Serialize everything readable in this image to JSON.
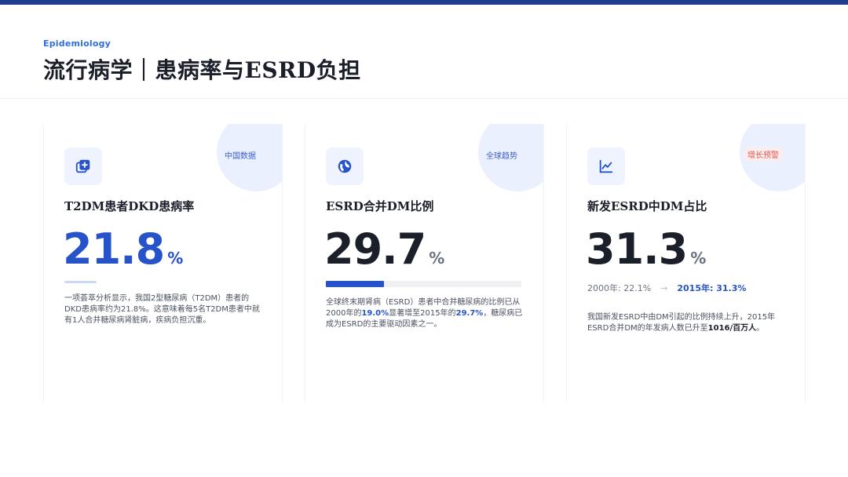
{
  "header": {
    "eyebrow": "Epidemiology",
    "title": "流行病学｜患病率与ESRD负担"
  },
  "cards": [
    {
      "tag": "中国数据",
      "icon": "medical-plus-icon",
      "title": "T2DM患者DKD患病率",
      "value": "21.8",
      "unit": "%",
      "desc": "一项荟萃分析显示，我国2型糖尿病（T2DM）患者的DKD患病率约为21.8%。这意味着每5名T2DM患者中就有1人合并糖尿病肾脏病，疾病负担沉重。"
    },
    {
      "tag": "全球趋势",
      "icon": "globe-icon",
      "title": "ESRD合并DM比例",
      "value": "29.7",
      "unit": "%",
      "progress": 0.297,
      "desc_parts": {
        "p1": "全球终末期肾病（ESRD）患者中合并糖尿病的比例已从2000年的",
        "v1": "19.0%",
        "p2": "显著增至2015年的",
        "v2": "29.7%",
        "p3": "，糖尿病已成为ESRD的主要驱动因素之一。"
      }
    },
    {
      "tag": "增长预警",
      "icon": "line-chart-icon",
      "title": "新发ESRD中DM占比",
      "value": "31.3",
      "unit": "%",
      "compare_from": "2000年: 22.1%",
      "compare_arrow": "→",
      "compare_to": "2015年: 31.3%",
      "desc_parts": {
        "p1": "我国新发ESRD中由DM引起的比例持续上升，2015年ESRD合并DM的年发病人数已升至",
        "v1": "1016/百万人",
        "p2": "。"
      }
    }
  ],
  "colors": {
    "brand": "#1f3d8f",
    "accent": "#2653c9",
    "warn": "#e05858"
  }
}
